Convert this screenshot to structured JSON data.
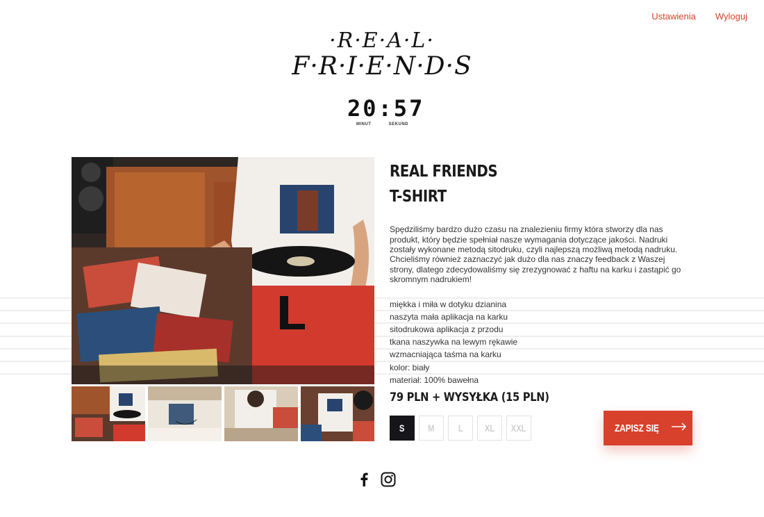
{
  "nav": {
    "settings_label": "Ustawienia",
    "logout_label": "Wyloguj"
  },
  "logo": {
    "line1": "·R·E·A·L·",
    "line2": "F·R·I·E·N·D·S"
  },
  "countdown": {
    "value": "20:57",
    "minutes_label": "MINUT",
    "seconds_label": "SEKUND"
  },
  "product": {
    "title_line1": "REAL FRIENDS",
    "title_line2": "T-SHIRT",
    "description": "Spędziliśmy bardzo dużo czasu na znalezieniu firmy która stworzy dla nas produkt, który będzie spełniał nasze wymagania dotyczące jakości. Nadruki zostały wykonane metodą sitodruku, czyli najlepszą możliwą metodą nadruku. Chcieliśmy również zaznaczyć jak dużo dla nas znaczy feedback z Waszej strony, dlatego zdecydowaliśmy się zrezygnować z haftu na karku i zastąpić go skromnym nadrukiem!",
    "features": [
      "miękka i miła w dotyku dzianina",
      "naszyta mała aplikacja na karku",
      "sitodrukowa aplikacja z przodu",
      "tkana naszywka na lewym rękawie",
      "wzmacniająca taśma na karku",
      "kolor: biały",
      "materiał: 100% bawełna"
    ],
    "price": "79 PLN + WYSYŁKA (15 PLN)",
    "sizes": [
      "S",
      "M",
      "L",
      "XL",
      "XXL"
    ],
    "selected_size": "S",
    "cta_label": "ZAPISZ SIĘ"
  },
  "colors": {
    "accent": "#d8412b",
    "dark": "#15151a"
  },
  "icons": {
    "social": [
      "facebook-icon",
      "instagram-icon"
    ],
    "cta": "arrow-right-icon"
  }
}
